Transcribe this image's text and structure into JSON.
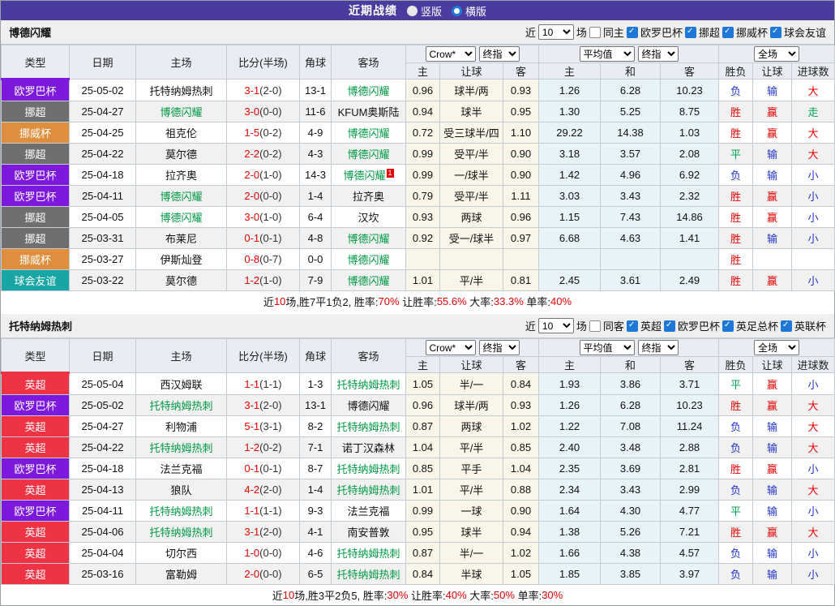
{
  "title_bar": {
    "title": "近期战绩",
    "options": [
      {
        "label": "竖版",
        "selected": false
      },
      {
        "label": "横版",
        "selected": true
      }
    ]
  },
  "table_header": {
    "near_prefix": "近",
    "near_count": "10",
    "near_suffix": "场",
    "match_cols": [
      "类型",
      "日期",
      "主场",
      "比分(半场)",
      "角球",
      "客场"
    ],
    "odds_sub": [
      "主",
      "让球",
      "客"
    ],
    "avg_sub": [
      "主",
      "和",
      "客"
    ],
    "result_sub": [
      "胜负",
      "让球",
      "进球数"
    ],
    "selects": {
      "book": "Crow*",
      "book_final": "终指",
      "avg": "平均值",
      "avg_final": "终指",
      "scope": "全场"
    }
  },
  "league_colors": {
    "欧罗巴杯": "#7d18dd",
    "挪超": "#6f6f6f",
    "挪威杯": "#de8e3c",
    "球会友谊": "#18a5a5",
    "英超": "#ee3344"
  },
  "result_colors": {
    "胜": "#e60000",
    "赢": "#e60000",
    "大": "#e60000",
    "平": "#00a050",
    "走": "#00a050",
    "负": "#2233cc",
    "输": "#2233cc",
    "小": "#2233cc"
  },
  "sections": [
    {
      "team": "博德闪耀",
      "accent": "#7d18dd",
      "same_venue_label": "同主",
      "same_checked": false,
      "leagues": [
        "欧罗巴杯",
        "挪超",
        "挪威杯",
        "球会友谊"
      ],
      "rows": [
        {
          "league": "欧罗巴杯",
          "date": "25-05-02",
          "home": "托特纳姆热刺",
          "home_hl": false,
          "home_sup": "",
          "score": "3-1",
          "half": "(2-0)",
          "corners": "13-1",
          "away": "博德闪耀",
          "away_hl": true,
          "away_sup": "",
          "odds": [
            "0.96",
            "球半/两",
            "0.93"
          ],
          "avg": [
            "1.26",
            "6.28",
            "10.23"
          ],
          "results": [
            "负",
            "输",
            "大"
          ]
        },
        {
          "league": "挪超",
          "date": "25-04-27",
          "home": "博德闪耀",
          "home_hl": true,
          "home_sup": "",
          "score": "3-0",
          "half": "(0-0)",
          "corners": "11-6",
          "away": "KFUM奥斯陆",
          "away_hl": false,
          "away_sup": "",
          "odds": [
            "0.94",
            "球半",
            "0.95"
          ],
          "avg": [
            "1.30",
            "5.25",
            "8.75"
          ],
          "results": [
            "胜",
            "赢",
            "走"
          ]
        },
        {
          "league": "挪威杯",
          "date": "25-04-25",
          "home": "祖克伦",
          "home_hl": false,
          "home_sup": "",
          "score": "1-5",
          "half": "(0-2)",
          "corners": "4-9",
          "away": "博德闪耀",
          "away_hl": true,
          "away_sup": "",
          "odds": [
            "0.72",
            "受三球半/四",
            "1.10"
          ],
          "avg": [
            "29.22",
            "14.38",
            "1.03"
          ],
          "results": [
            "胜",
            "赢",
            "大"
          ]
        },
        {
          "league": "挪超",
          "date": "25-04-22",
          "home": "莫尔德",
          "home_hl": false,
          "home_sup": "",
          "score": "2-2",
          "half": "(0-2)",
          "corners": "4-3",
          "away": "博德闪耀",
          "away_hl": true,
          "away_sup": "",
          "odds": [
            "0.99",
            "受平/半",
            "0.90"
          ],
          "avg": [
            "3.18",
            "3.57",
            "2.08"
          ],
          "results": [
            "平",
            "输",
            "大"
          ]
        },
        {
          "league": "欧罗巴杯",
          "date": "25-04-18",
          "home": "拉齐奥",
          "home_hl": false,
          "home_sup": "",
          "score": "2-0",
          "half": "(1-0)",
          "corners": "14-3",
          "away": "博德闪耀",
          "away_hl": true,
          "away_sup": "1",
          "odds": [
            "0.99",
            "一/球半",
            "0.90"
          ],
          "avg": [
            "1.42",
            "4.96",
            "6.92"
          ],
          "results": [
            "负",
            "输",
            "小"
          ]
        },
        {
          "league": "欧罗巴杯",
          "date": "25-04-11",
          "home": "博德闪耀",
          "home_hl": true,
          "home_sup": "",
          "score": "2-0",
          "half": "(0-0)",
          "corners": "1-4",
          "away": "拉齐奥",
          "away_hl": false,
          "away_sup": "",
          "odds": [
            "0.79",
            "受平/半",
            "1.11"
          ],
          "avg": [
            "3.03",
            "3.43",
            "2.32"
          ],
          "results": [
            "胜",
            "赢",
            "小"
          ]
        },
        {
          "league": "挪超",
          "date": "25-04-05",
          "home": "博德闪耀",
          "home_hl": true,
          "home_sup": "",
          "score": "3-0",
          "half": "(1-0)",
          "corners": "6-4",
          "away": "汉坎",
          "away_hl": false,
          "away_sup": "",
          "odds": [
            "0.93",
            "两球",
            "0.96"
          ],
          "avg": [
            "1.15",
            "7.43",
            "14.86"
          ],
          "results": [
            "胜",
            "赢",
            "小"
          ]
        },
        {
          "league": "挪超",
          "date": "25-03-31",
          "home": "布莱尼",
          "home_hl": false,
          "home_sup": "",
          "score": "0-1",
          "half": "(0-1)",
          "corners": "4-8",
          "away": "博德闪耀",
          "away_hl": true,
          "away_sup": "",
          "odds": [
            "0.92",
            "受一/球半",
            "0.97"
          ],
          "avg": [
            "6.68",
            "4.63",
            "1.41"
          ],
          "results": [
            "胜",
            "输",
            "小"
          ]
        },
        {
          "league": "挪威杯",
          "date": "25-03-27",
          "home": "伊斯灿登",
          "home_hl": false,
          "home_sup": "",
          "score": "0-8",
          "half": "(0-7)",
          "corners": "0-0",
          "away": "博德闪耀",
          "away_hl": true,
          "away_sup": "",
          "odds": [
            "",
            "",
            ""
          ],
          "avg": [
            "",
            "",
            ""
          ],
          "results": [
            "胜",
            "",
            ""
          ]
        },
        {
          "league": "球会友谊",
          "date": "25-03-22",
          "home": "莫尔德",
          "home_hl": false,
          "home_sup": "",
          "score": "1-2",
          "half": "(1-0)",
          "corners": "7-9",
          "away": "博德闪耀",
          "away_hl": true,
          "away_sup": "",
          "odds": [
            "1.01",
            "平/半",
            "0.81"
          ],
          "avg": [
            "2.45",
            "3.61",
            "2.49"
          ],
          "results": [
            "胜",
            "赢",
            "小"
          ]
        }
      ],
      "summary": [
        {
          "t": "近",
          "c": ""
        },
        {
          "t": "10",
          "c": "r"
        },
        {
          "t": "场,胜7平1负2, 胜率:",
          "c": ""
        },
        {
          "t": "70%",
          "c": "r"
        },
        {
          "t": " 让胜率:",
          "c": ""
        },
        {
          "t": "55.6%",
          "c": "r"
        },
        {
          "t": " 大率:",
          "c": ""
        },
        {
          "t": "33.3%",
          "c": "r"
        },
        {
          "t": " 单率:",
          "c": ""
        },
        {
          "t": "40%",
          "c": "r"
        }
      ]
    },
    {
      "team": "托特纳姆热刺",
      "accent": "#ee3344",
      "same_venue_label": "同客",
      "same_checked": false,
      "leagues": [
        "英超",
        "欧罗巴杯",
        "英足总杯",
        "英联杯"
      ],
      "rows": [
        {
          "league": "英超",
          "date": "25-05-04",
          "home": "西汉姆联",
          "home_hl": false,
          "home_sup": "",
          "score": "1-1",
          "half": "(1-1)",
          "corners": "1-3",
          "away": "托特纳姆热刺",
          "away_hl": true,
          "away_sup": "",
          "odds": [
            "1.05",
            "半/一",
            "0.84"
          ],
          "avg": [
            "1.93",
            "3.86",
            "3.71"
          ],
          "results": [
            "平",
            "赢",
            "小"
          ]
        },
        {
          "league": "欧罗巴杯",
          "date": "25-05-02",
          "home": "托特纳姆热刺",
          "home_hl": true,
          "home_sup": "",
          "score": "3-1",
          "half": "(2-0)",
          "corners": "13-1",
          "away": "博德闪耀",
          "away_hl": false,
          "away_sup": "",
          "odds": [
            "0.96",
            "球半/两",
            "0.93"
          ],
          "avg": [
            "1.26",
            "6.28",
            "10.23"
          ],
          "results": [
            "胜",
            "赢",
            "大"
          ]
        },
        {
          "league": "英超",
          "date": "25-04-27",
          "home": "利物浦",
          "home_hl": false,
          "home_sup": "",
          "score": "5-1",
          "half": "(3-1)",
          "corners": "8-2",
          "away": "托特纳姆热刺",
          "away_hl": true,
          "away_sup": "",
          "odds": [
            "0.87",
            "两球",
            "1.02"
          ],
          "avg": [
            "1.22",
            "7.08",
            "11.24"
          ],
          "results": [
            "负",
            "输",
            "大"
          ]
        },
        {
          "league": "英超",
          "date": "25-04-22",
          "home": "托特纳姆热刺",
          "home_hl": true,
          "home_sup": "",
          "score": "1-2",
          "half": "(0-2)",
          "corners": "7-1",
          "away": "诺丁汉森林",
          "away_hl": false,
          "away_sup": "",
          "odds": [
            "1.04",
            "平/半",
            "0.85"
          ],
          "avg": [
            "2.40",
            "3.48",
            "2.88"
          ],
          "results": [
            "负",
            "输",
            "大"
          ]
        },
        {
          "league": "欧罗巴杯",
          "date": "25-04-18",
          "home": "法兰克福",
          "home_hl": false,
          "home_sup": "",
          "score": "0-1",
          "half": "(0-1)",
          "corners": "8-7",
          "away": "托特纳姆热刺",
          "away_hl": true,
          "away_sup": "",
          "odds": [
            "0.85",
            "平手",
            "1.04"
          ],
          "avg": [
            "2.35",
            "3.69",
            "2.81"
          ],
          "results": [
            "胜",
            "赢",
            "小"
          ]
        },
        {
          "league": "英超",
          "date": "25-04-13",
          "home": "狼队",
          "home_hl": false,
          "home_sup": "",
          "score": "4-2",
          "half": "(2-0)",
          "corners": "1-4",
          "away": "托特纳姆热刺",
          "away_hl": true,
          "away_sup": "",
          "odds": [
            "1.01",
            "平/半",
            "0.88"
          ],
          "avg": [
            "2.34",
            "3.43",
            "2.99"
          ],
          "results": [
            "负",
            "输",
            "大"
          ]
        },
        {
          "league": "欧罗巴杯",
          "date": "25-04-11",
          "home": "托特纳姆热刺",
          "home_hl": true,
          "home_sup": "",
          "score": "1-1",
          "half": "(1-1)",
          "corners": "9-3",
          "away": "法兰克福",
          "away_hl": false,
          "away_sup": "",
          "odds": [
            "0.99",
            "一球",
            "0.90"
          ],
          "avg": [
            "1.64",
            "4.30",
            "4.77"
          ],
          "results": [
            "平",
            "输",
            "小"
          ]
        },
        {
          "league": "英超",
          "date": "25-04-06",
          "home": "托特纳姆热刺",
          "home_hl": true,
          "home_sup": "",
          "score": "3-1",
          "half": "(2-0)",
          "corners": "4-1",
          "away": "南安普敦",
          "away_hl": false,
          "away_sup": "",
          "odds": [
            "0.95",
            "球半",
            "0.94"
          ],
          "avg": [
            "1.38",
            "5.26",
            "7.21"
          ],
          "results": [
            "胜",
            "赢",
            "大"
          ]
        },
        {
          "league": "英超",
          "date": "25-04-04",
          "home": "切尔西",
          "home_hl": false,
          "home_sup": "",
          "score": "1-0",
          "half": "(0-0)",
          "corners": "4-6",
          "away": "托特纳姆热刺",
          "away_hl": true,
          "away_sup": "",
          "odds": [
            "0.87",
            "半/一",
            "1.02"
          ],
          "avg": [
            "1.66",
            "4.38",
            "4.57"
          ],
          "results": [
            "负",
            "输",
            "小"
          ]
        },
        {
          "league": "英超",
          "date": "25-03-16",
          "home": "富勒姆",
          "home_hl": false,
          "home_sup": "",
          "score": "2-0",
          "half": "(0-0)",
          "corners": "6-5",
          "away": "托特纳姆热刺",
          "away_hl": true,
          "away_sup": "",
          "odds": [
            "0.84",
            "半球",
            "1.05"
          ],
          "avg": [
            "1.85",
            "3.85",
            "3.97"
          ],
          "results": [
            "负",
            "输",
            "小"
          ]
        }
      ],
      "summary": [
        {
          "t": "近",
          "c": ""
        },
        {
          "t": "10",
          "c": "r"
        },
        {
          "t": "场,胜3平2负5, 胜率:",
          "c": ""
        },
        {
          "t": "30%",
          "c": "r"
        },
        {
          "t": " 让胜率:",
          "c": ""
        },
        {
          "t": "40%",
          "c": "r"
        },
        {
          "t": " 大率:",
          "c": ""
        },
        {
          "t": "50%",
          "c": "r"
        },
        {
          "t": " 单率:",
          "c": ""
        },
        {
          "t": "30%",
          "c": "r"
        }
      ]
    }
  ]
}
